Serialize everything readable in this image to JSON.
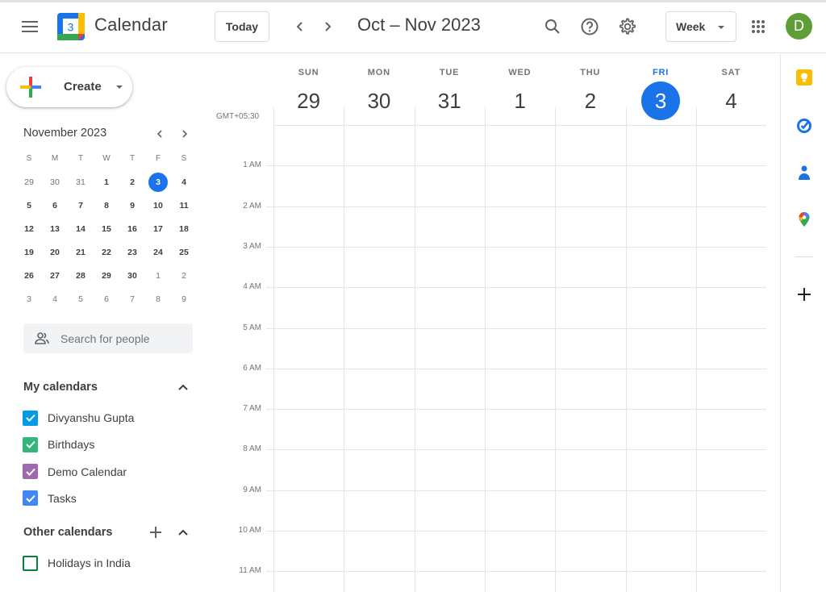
{
  "header": {
    "app_title": "Calendar",
    "logo_day": "3",
    "today_label": "Today",
    "period_title": "Oct – Nov 2023",
    "view_select": "Week",
    "avatar_initial": "D",
    "icons": [
      "menu-icon",
      "chevron-left-icon",
      "chevron-right-icon",
      "search-icon",
      "help-icon",
      "settings-icon",
      "apps-grid-icon"
    ]
  },
  "sidebar": {
    "create_label": "Create",
    "mini_calendar": {
      "title": "November 2023",
      "weekday_headers": [
        "S",
        "M",
        "T",
        "W",
        "T",
        "F",
        "S"
      ],
      "weeks": [
        [
          {
            "d": "29",
            "other": true
          },
          {
            "d": "30",
            "other": true
          },
          {
            "d": "31",
            "other": true
          },
          {
            "d": "1"
          },
          {
            "d": "2"
          },
          {
            "d": "3",
            "today": true
          },
          {
            "d": "4"
          }
        ],
        [
          {
            "d": "5"
          },
          {
            "d": "6"
          },
          {
            "d": "7"
          },
          {
            "d": "8"
          },
          {
            "d": "9"
          },
          {
            "d": "10"
          },
          {
            "d": "11"
          }
        ],
        [
          {
            "d": "12"
          },
          {
            "d": "13"
          },
          {
            "d": "14"
          },
          {
            "d": "15"
          },
          {
            "d": "16"
          },
          {
            "d": "17"
          },
          {
            "d": "18"
          }
        ],
        [
          {
            "d": "19"
          },
          {
            "d": "20"
          },
          {
            "d": "21"
          },
          {
            "d": "22"
          },
          {
            "d": "23"
          },
          {
            "d": "24"
          },
          {
            "d": "25"
          }
        ],
        [
          {
            "d": "26"
          },
          {
            "d": "27"
          },
          {
            "d": "28"
          },
          {
            "d": "29"
          },
          {
            "d": "30"
          },
          {
            "d": "1",
            "other": true
          },
          {
            "d": "2",
            "other": true
          }
        ],
        [
          {
            "d": "3",
            "other": true
          },
          {
            "d": "4",
            "other": true
          },
          {
            "d": "5",
            "other": true
          },
          {
            "d": "6",
            "other": true
          },
          {
            "d": "7",
            "other": true
          },
          {
            "d": "8",
            "other": true
          },
          {
            "d": "9",
            "other": true
          }
        ]
      ]
    },
    "search_people_placeholder": "Search for people",
    "my_calendars": {
      "title": "My calendars",
      "items": [
        {
          "name": "Divyanshu Gupta",
          "color": "#039be5",
          "checked": true
        },
        {
          "name": "Birthdays",
          "color": "#33b679",
          "checked": true
        },
        {
          "name": "Demo Calendar",
          "color": "#9e69af",
          "checked": true
        },
        {
          "name": "Tasks",
          "color": "#4285f4",
          "checked": true
        }
      ]
    },
    "other_calendars": {
      "title": "Other calendars",
      "items": [
        {
          "name": "Holidays in India",
          "color": "#0b8043",
          "checked": false
        }
      ]
    }
  },
  "week": {
    "timezone": "GMT+05:30",
    "days": [
      {
        "dow": "SUN",
        "num": "29",
        "today": false
      },
      {
        "dow": "MON",
        "num": "30",
        "today": false
      },
      {
        "dow": "TUE",
        "num": "31",
        "today": false
      },
      {
        "dow": "WED",
        "num": "1",
        "today": false
      },
      {
        "dow": "THU",
        "num": "2",
        "today": false
      },
      {
        "dow": "FRI",
        "num": "3",
        "today": true
      },
      {
        "dow": "SAT",
        "num": "4",
        "today": false
      }
    ],
    "hours": [
      "1 AM",
      "2 AM",
      "3 AM",
      "4 AM",
      "5 AM",
      "6 AM",
      "7 AM",
      "8 AM",
      "9 AM",
      "10 AM",
      "11 AM"
    ]
  },
  "side_panel": {
    "apps": [
      "keep-icon",
      "tasks-icon",
      "contacts-icon",
      "maps-icon"
    ],
    "add_label": "+"
  },
  "colors": {
    "accent": "#1a73e8",
    "avatar": "#5f9e36"
  }
}
